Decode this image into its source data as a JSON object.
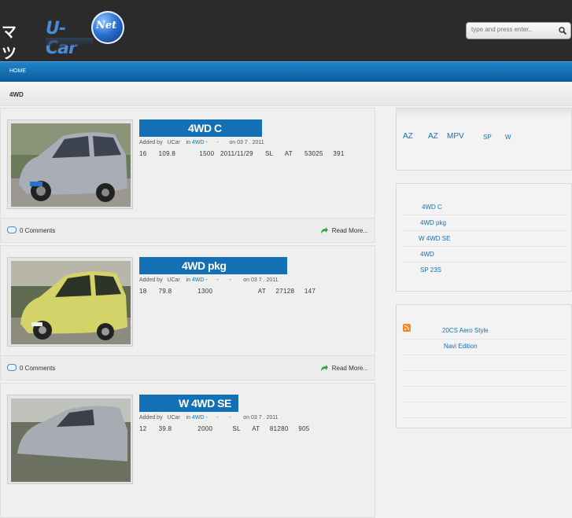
{
  "header": {
    "logo_kana": "マツダ",
    "logo_ucar": "U-Car",
    "logo_net": "Net",
    "search_placeholder": "type and press enter.."
  },
  "nav": {
    "home": "HOME"
  },
  "breadcrumb": "4WD",
  "posts": [
    {
      "title": "4WD C",
      "meta_prefix": "Added by   UCar    in ",
      "meta_link": "4WD",
      "meta_suffix": " -      -       on 03 7 . 2011",
      "specs": "16      109.8            1500   2011/11/29      SL      AT      53025     391",
      "comments": "0 Comments",
      "read_more": "Read More...",
      "car_color": "#a9adb8"
    },
    {
      "title": "4WD                 pkg",
      "meta_prefix": "Added by   UCar    in ",
      "meta_link": "4WD",
      "meta_suffix": " -      -       -        on 03 7 . 2011",
      "specs": "18      79.8             1300                       AT     27128     147",
      "comments": "0 Comments",
      "read_more": "Read More...",
      "car_color": "#d4d36a"
    },
    {
      "title": "W 4WD SE",
      "meta_prefix": "Added by   UCar    in ",
      "meta_link": "4WD",
      "meta_suffix": " -      -       -        on 03 7 . 2011",
      "specs": "12      39.8             2000          SL      AT     81280     905",
      "comments": "",
      "read_more": "",
      "car_color": "#a7abb2"
    }
  ],
  "sidebar": {
    "categories": [
      "AZ",
      "AZ",
      "MPV",
      "SP",
      "W"
    ],
    "recent": [
      "4WD C",
      "4WD            pkg",
      "W 4WD SE",
      "4WD",
      "SP 23S"
    ],
    "feed": [
      "20CS Aero Style",
      "Navi Edition"
    ]
  }
}
